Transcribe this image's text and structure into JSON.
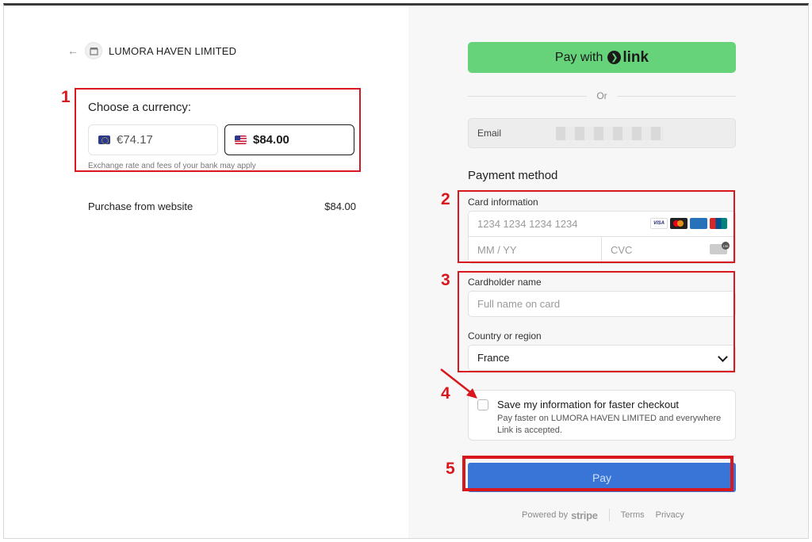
{
  "merchant": {
    "back_icon": "arrow-left-icon",
    "store_icon": "store-icon",
    "name": "LUMORA HAVEN LIMITED"
  },
  "currency": {
    "title": "Choose a currency:",
    "options": [
      {
        "flag": "eu-flag",
        "amount": "€74.17",
        "selected": false
      },
      {
        "flag": "us-flag",
        "amount": "$84.00",
        "selected": true
      }
    ],
    "note": "Exchange rate and fees of your bank may apply"
  },
  "summary": {
    "item": "Purchase from website",
    "price": "$84.00"
  },
  "link_button": {
    "label": "Pay with",
    "brand": "link"
  },
  "divider": {
    "text": "Or"
  },
  "email": {
    "label": "Email"
  },
  "payment": {
    "title": "Payment method",
    "card_label": "Card information",
    "card_number_placeholder": "1234 1234 1234 1234",
    "card_brands": [
      "VISA",
      "mastercard",
      "AMEX",
      "UnionPay"
    ],
    "expiry_placeholder": "MM / YY",
    "cvc_placeholder": "CVC",
    "cardholder_label": "Cardholder name",
    "cardholder_placeholder": "Full name on card",
    "country_label": "Country or region",
    "country_value": "France"
  },
  "save_info": {
    "title": "Save my information for faster checkout",
    "description": "Pay faster on LUMORA HAVEN LIMITED and everywhere Link is accepted.",
    "checked": false
  },
  "pay_button": {
    "label": "Pay"
  },
  "footer": {
    "powered_by": "Powered by",
    "brand": "stripe",
    "terms": "Terms",
    "privacy": "Privacy"
  },
  "annotations": {
    "steps": [
      "1",
      "2",
      "3",
      "4",
      "5"
    ],
    "color": "#d9181e"
  }
}
